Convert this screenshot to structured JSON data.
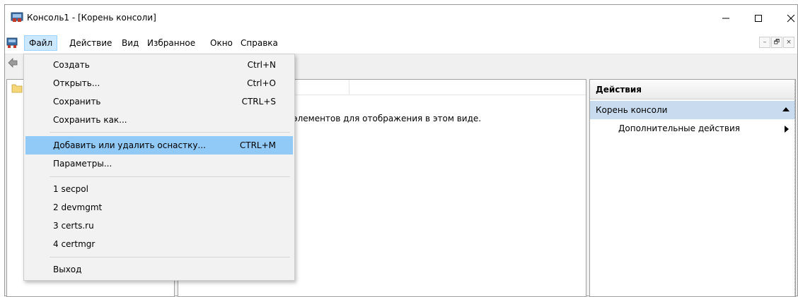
{
  "window": {
    "title": "Консоль1 - [Корень консоли]",
    "controls": {
      "minimize": "—",
      "maximize": "☐",
      "close": "✕"
    }
  },
  "menubar": {
    "items": [
      {
        "label": "Файл",
        "active": true
      },
      {
        "label": "Действие"
      },
      {
        "label": "Вид"
      },
      {
        "label": "Избранное"
      },
      {
        "label": "Окно"
      },
      {
        "label": "Справка"
      }
    ],
    "mdi_controls": [
      "–",
      "🗗",
      "×"
    ]
  },
  "file_menu": {
    "items": [
      {
        "label": "Создать",
        "shortcut": "Ctrl+N"
      },
      {
        "label": "Открыть...",
        "shortcut": "Ctrl+O"
      },
      {
        "label": "Сохранить",
        "shortcut": "CTRL+S"
      },
      {
        "label": "Сохранить как...",
        "shortcut": ""
      },
      {
        "label": "Добавить или удалить оснастку...",
        "shortcut": "CTRL+M",
        "highlighted": true
      },
      {
        "label": "Параметры...",
        "shortcut": ""
      },
      {
        "label": "1 secpol",
        "shortcut": ""
      },
      {
        "label": "2 devmgmt",
        "shortcut": ""
      },
      {
        "label": "3 certs.ru",
        "shortcut": ""
      },
      {
        "label": "4 certmgr",
        "shortcut": ""
      },
      {
        "label": "Выход",
        "shortcut": ""
      }
    ]
  },
  "center": {
    "empty_message": "элементов для отображения в этом виде."
  },
  "actions": {
    "header": "Действия",
    "section": "Корень консоли",
    "more": "Дополнительные действия"
  },
  "colors": {
    "menu_highlight": "#91c9f7",
    "menubar_active": "#cce8ff",
    "actions_section": "#c9dcef"
  }
}
